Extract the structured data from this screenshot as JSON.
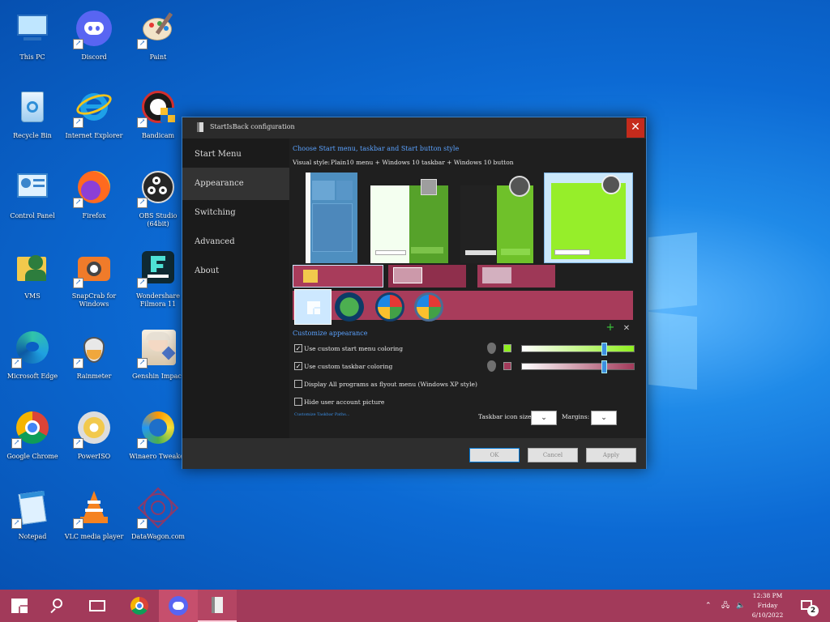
{
  "desktop_icons": [
    {
      "label": "This PC",
      "icon": "this-pc-icon"
    },
    {
      "label": "Discord",
      "icon": "discord-icon"
    },
    {
      "label": "Paint",
      "icon": "paint-icon"
    },
    {
      "label": "Recycle Bin",
      "icon": "recycle-bin-icon"
    },
    {
      "label": "Internet Explorer",
      "icon": "internet-explorer-icon"
    },
    {
      "label": "Bandicam",
      "icon": "bandicam-icon"
    },
    {
      "label": "Control Panel",
      "icon": "control-panel-icon"
    },
    {
      "label": "Firefox",
      "icon": "firefox-icon"
    },
    {
      "label": "OBS Studio (64bit)",
      "icon": "obs-icon"
    },
    {
      "label": "VMS",
      "icon": "vms-folder-icon"
    },
    {
      "label": "SnapCrab for Windows",
      "icon": "snapcrab-icon"
    },
    {
      "label": "Wondershare Filmora 11",
      "icon": "filmora-icon"
    },
    {
      "label": "Microsoft Edge",
      "icon": "edge-icon"
    },
    {
      "label": "Rainmeter",
      "icon": "rainmeter-icon"
    },
    {
      "label": "Genshin Impact",
      "icon": "genshin-icon"
    },
    {
      "label": "Google Chrome",
      "icon": "chrome-icon"
    },
    {
      "label": "PowerISO",
      "icon": "poweriso-icon"
    },
    {
      "label": "Winaero Tweaker",
      "icon": "winaero-icon"
    },
    {
      "label": "Notepad",
      "icon": "notepad-icon"
    },
    {
      "label": "VLC media player",
      "icon": "vlc-icon"
    },
    {
      "label": "DataWagon.com",
      "icon": "datawagon-icon"
    }
  ],
  "dialog": {
    "title": "StartIsBack configuration",
    "close": "✕",
    "nav": [
      "Start Menu",
      "Appearance",
      "Switching",
      "Advanced",
      "About"
    ],
    "selected_nav": "Appearance",
    "section_style": "Choose Start menu, taskbar and Start button style",
    "visual_style_label": "Visual style:",
    "visual_style_value": "Plain10 menu + Windows 10 taskbar + Windows 10 button",
    "section_customize": "Customize appearance",
    "options": [
      {
        "label": "Use custom start menu coloring",
        "checked": true
      },
      {
        "label": "Use custom taskbar coloring",
        "checked": true
      },
      {
        "label": "Display All programs as flyout menu (Windows XP style)",
        "checked": false
      },
      {
        "label": "Hide user account picture",
        "checked": false
      }
    ],
    "color_start": "#8fef1f",
    "color_taskbar": "#a23a5a",
    "slider_start": 0.75,
    "slider_taskbar": 0.75,
    "link": "Customize Taskbar Paths...",
    "taskbar_icon_size_label": "Taskbar icon size:",
    "margins_label": "Margins:",
    "combo_arrow": "⌄",
    "buttons": {
      "ok": "OK",
      "cancel": "Cancel",
      "apply": "Apply"
    },
    "add_icon": "+",
    "remove_icon": "✕"
  },
  "taskbar": {
    "color": "#a23a5a",
    "clock_time": "12:38 PM",
    "clock_day": "Friday",
    "clock_date": "6/10/2022",
    "notification_count": "2"
  }
}
